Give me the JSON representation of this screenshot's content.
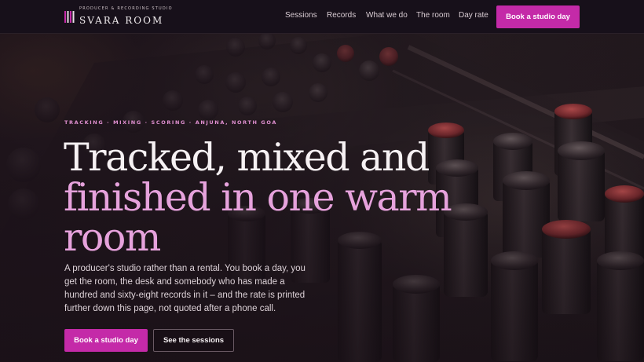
{
  "header": {
    "brand_tagline": "PRODUCER & RECORDING STUDIO",
    "brand_name": "SVARA ROOM",
    "nav": [
      "Sessions",
      "Records",
      "What we do",
      "The room",
      "Day rate"
    ],
    "cta_label": "Book a studio day"
  },
  "hero": {
    "eyebrow": "TRACKING · MIXING · SCORING · ANJUNA, NORTH GOA",
    "headline_line1": "Tracked, mixed and",
    "headline_line2": "finished in one warm room",
    "lede": "A producer's studio rather than a rental. You book a day, you get the room, the desk and somebody who has made a hundred and sixty-eight records in it – and the rate is printed further down this page, not quoted after a phone call.",
    "primary_button": "Book a studio day",
    "secondary_button": "See the sessions"
  },
  "colors": {
    "accent": "#c42aa8",
    "headline_pink": "#e6a2dc",
    "eyebrow_pink": "#df8fd0",
    "header_bg": "#17101a"
  },
  "icons": {
    "brand": "equalizer-bars-icon"
  }
}
